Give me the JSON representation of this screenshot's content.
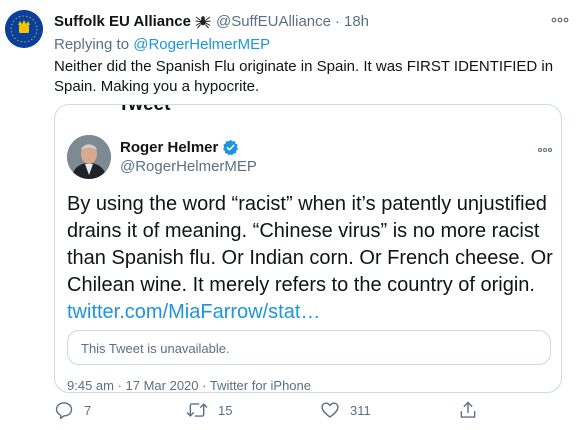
{
  "tweet": {
    "display_name": "Suffolk EU Alliance",
    "name_emoji_icon": "spider-icon",
    "handle": "@SuffEUAlliance",
    "separator": "·",
    "time": "18h",
    "replying_prefix": "Replying to",
    "replying_to": "@RogerHelmerMEP",
    "text_line1": "Neither did the Spanish Flu originate in Spain. It was FIRST IDENTIFIED in",
    "text_line2": "Spain. Making you a hypocrite.",
    "avatar_ring_text": "SUFFOLK EU ALLIANCE"
  },
  "quote": {
    "clipped_title": "Tweet",
    "display_name": "Roger Helmer",
    "verified": true,
    "handle": "@RogerHelmerMEP",
    "body_line1": "By using the word “racist” when it’s patently unjustified",
    "body_line2": "drains it of meaning. “Chinese virus” is no more racist",
    "body_line3": "than Spanish flu. Or Indian corn. Or French cheese. Or",
    "body_line4": "Chilean wine. It merely refers to the country of origin.",
    "link": "twitter.com/MiaFarrow/stat…",
    "unavailable": "This Tweet is unavailable.",
    "meta": "9:45 am · 17 Mar 2020 · Twitter for iPhone"
  },
  "actions": {
    "reply_count": "7",
    "retweet_count": "15",
    "like_count": "311"
  },
  "colors": {
    "accent": "#1b95e0",
    "muted": "#5b7083",
    "border": "#cfd9de",
    "avatar_blue": "#0b3f9e",
    "star_gold": "#f2c400"
  }
}
